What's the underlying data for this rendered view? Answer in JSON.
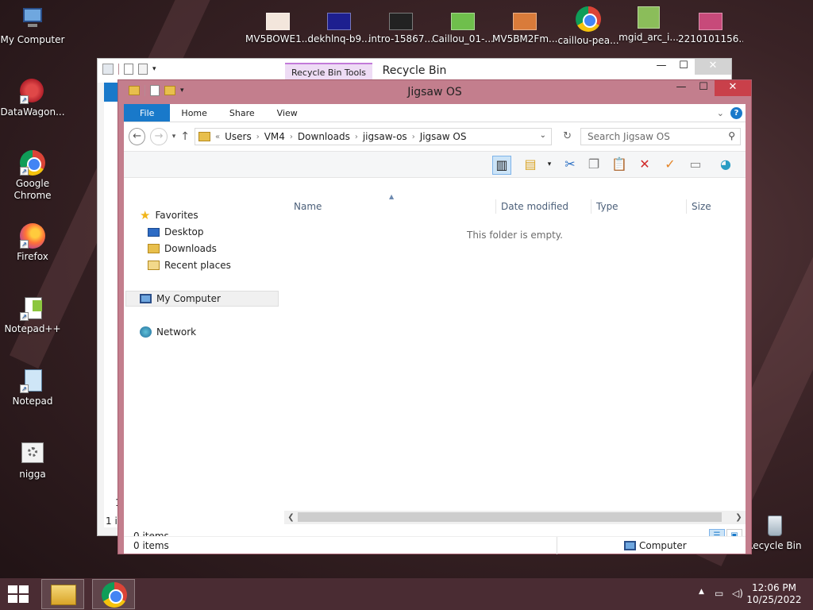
{
  "desktop": {
    "left_icons": [
      {
        "label": "My Computer"
      },
      {
        "label": "DataWagon..."
      },
      {
        "label": "Google Chrome"
      },
      {
        "label": "Firefox"
      },
      {
        "label": "Notepad++"
      },
      {
        "label": "Notepad"
      },
      {
        "label": "nigga"
      }
    ],
    "top_icons": [
      {
        "label": "MV5BOWE1..."
      },
      {
        "label": "dekhlnq-b9..."
      },
      {
        "label": "intro-15867..."
      },
      {
        "label": "Caillou_01-..."
      },
      {
        "label": "MV5BM2Fm..."
      },
      {
        "label": "caillou-pea..."
      },
      {
        "label": "mgid_arc_i..."
      },
      {
        "label": "2210101156..."
      }
    ],
    "recycle_bin": {
      "label": "Recycle Bin"
    }
  },
  "back_window": {
    "title": "Recycle Bin",
    "contextual_tab": "Recycle Bin Tools",
    "status_count": "1 it",
    "side_char": "1"
  },
  "window": {
    "title": "Jigsaw OS",
    "ribbon_tabs": {
      "file": "File",
      "home": "Home",
      "share": "Share",
      "view": "View"
    },
    "address": {
      "overflow": "«",
      "crumbs": [
        "Users",
        "VM4",
        "Downloads",
        "jigsaw-os",
        "Jigsaw OS"
      ]
    },
    "search_placeholder": "Search Jigsaw OS",
    "nav": {
      "favorites": "Favorites",
      "desktop": "Desktop",
      "downloads": "Downloads",
      "recent": "Recent places",
      "my_computer": "My Computer",
      "network": "Network"
    },
    "columns": {
      "name": "Name",
      "date": "Date modified",
      "type": "Type",
      "size": "Size"
    },
    "empty_message": "This folder is empty.",
    "inner_status": "0 items",
    "outer_status": "0 items",
    "location": "Computer"
  },
  "taskbar": {
    "time": "12:06 PM",
    "date": "10/25/2022"
  },
  "colors": {
    "accent": "#1979ca",
    "frame": "#c37e8d",
    "close": "#c9404a",
    "taskbar": "#4a2c33"
  }
}
